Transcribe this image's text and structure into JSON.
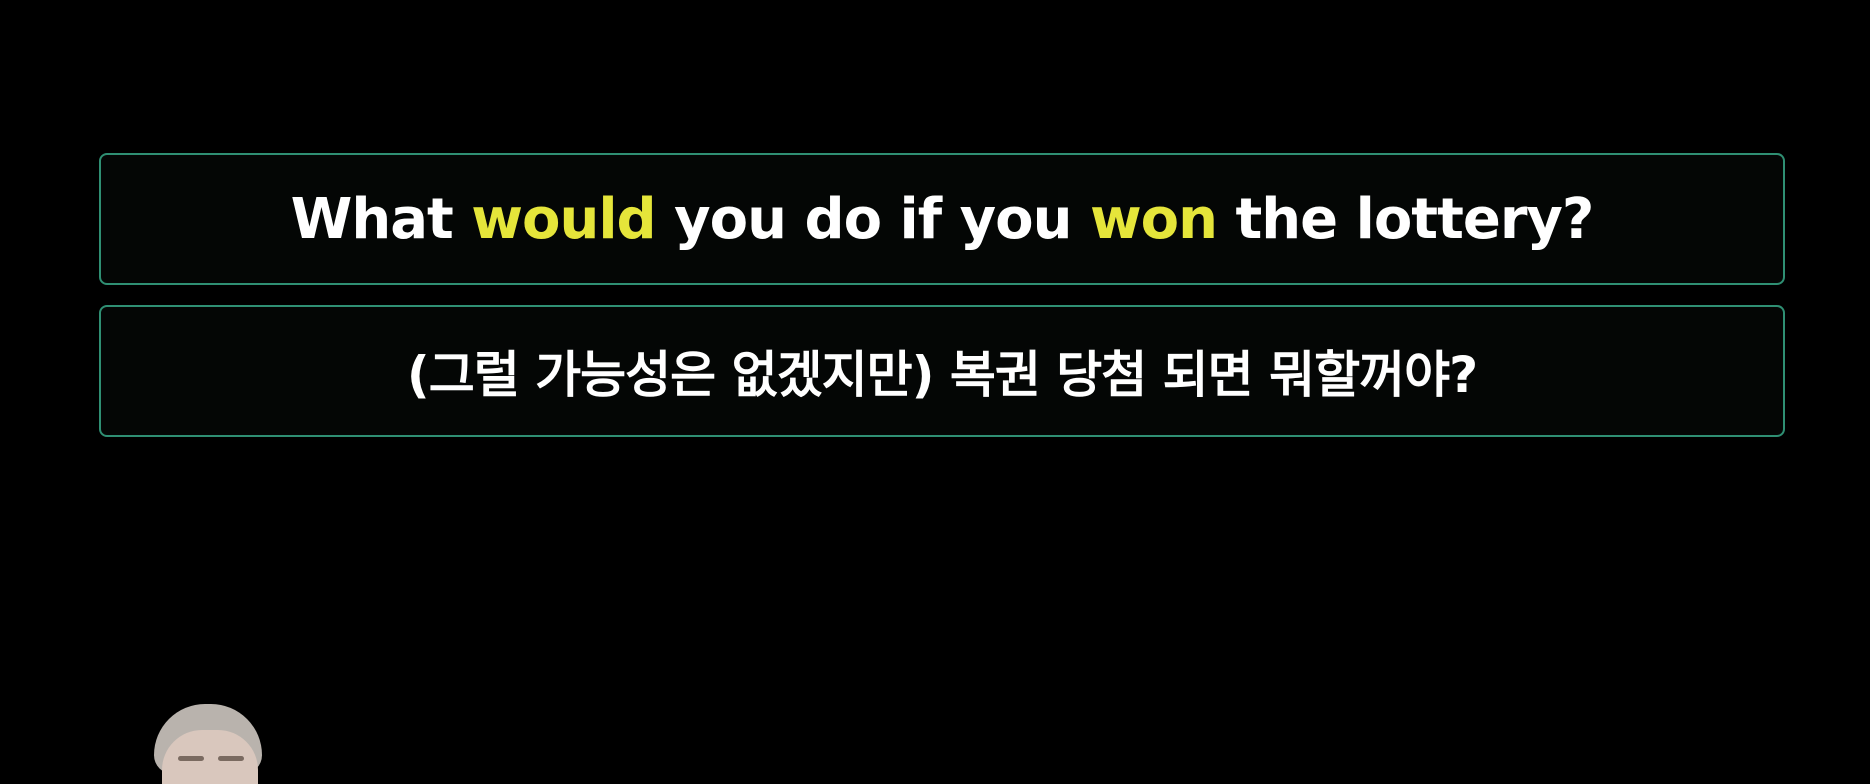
{
  "captions": {
    "english": {
      "parts": [
        {
          "text": "What ",
          "highlight": false
        },
        {
          "text": "would",
          "highlight": true
        },
        {
          "text": " you do if you ",
          "highlight": false
        },
        {
          "text": "won",
          "highlight": true
        },
        {
          "text": " the lottery?",
          "highlight": false
        }
      ]
    },
    "korean": {
      "text": "(그럴 가능성은 없겠지만) 복권 당첨 되면 뭐할꺼야?"
    }
  },
  "colors": {
    "background": "#000000",
    "text": "#ffffff",
    "highlight": "#e5e53a",
    "border": "#2f8f73"
  }
}
